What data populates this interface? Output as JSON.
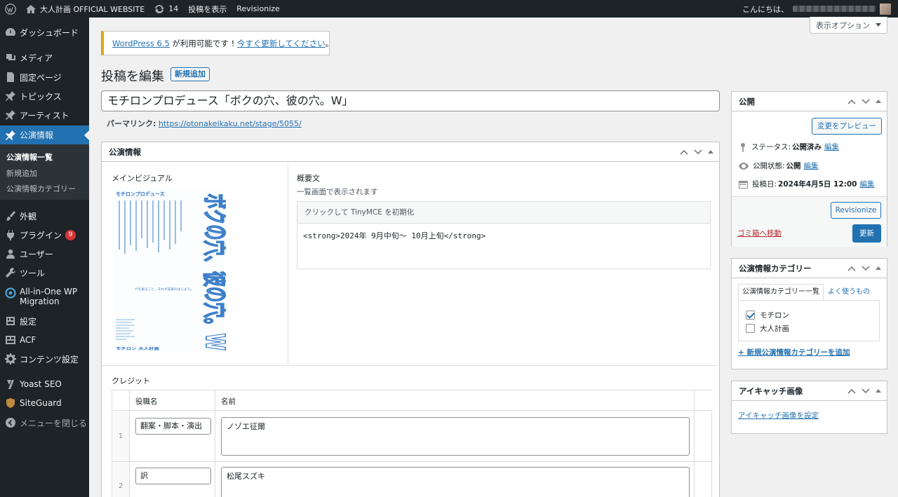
{
  "adminbar": {
    "site_name": "大人計画 OFFICIAL WEBSITE",
    "updates_count": "14",
    "view_post": "投稿を表示",
    "revisionize": "Revisionize",
    "greeting": "こんにちは、"
  },
  "sidebar": {
    "items": [
      {
        "label": "ダッシュボード",
        "icon": "dashboard-icon"
      },
      {
        "label": "メディア",
        "icon": "media-icon"
      },
      {
        "label": "固定ページ",
        "icon": "page-icon"
      },
      {
        "label": "トピックス",
        "icon": "pin-icon"
      },
      {
        "label": "アーティスト",
        "icon": "pin-icon"
      },
      {
        "label": "公演情報",
        "icon": "pin-icon"
      },
      {
        "label": "外観",
        "icon": "brush-icon"
      },
      {
        "label": "プラグイン",
        "icon": "plugin-icon",
        "badge": "9"
      },
      {
        "label": "ユーザー",
        "icon": "user-icon"
      },
      {
        "label": "ツール",
        "icon": "wrench-icon"
      },
      {
        "label": "All-in-One WP",
        "label2": "Migration",
        "icon": "migration-icon"
      },
      {
        "label": "設定",
        "icon": "settings-icon"
      },
      {
        "label": "ACF",
        "icon": "acf-icon"
      },
      {
        "label": "コンテンツ設定",
        "icon": "gear-icon"
      },
      {
        "label": "Yoast SEO",
        "icon": "yoast-icon"
      },
      {
        "label": "SiteGuard",
        "icon": "shield-icon"
      },
      {
        "label": "メニューを閉じる",
        "icon": "collapse-icon"
      }
    ],
    "submenu": [
      "公演情報一覧",
      "新規追加",
      "公演情報カテゴリー"
    ]
  },
  "screen_options": "表示オプション",
  "notice": {
    "link1": "WordPress 6.5",
    "text": " が利用可能です ! ",
    "link2": "今すぐ更新してください",
    "end": "。"
  },
  "page": {
    "title": "投稿を編集",
    "add_new": "新規追加",
    "post_title": "モチロンプロデュース「ボクの穴、彼の穴。W」",
    "permalink_label": "パーマリンク:",
    "permalink_url": "https://otonakeikaku.net/stage/5055/"
  },
  "meta": {
    "title": "公演情報",
    "main_visual_label": "メインビジュアル",
    "summary_label": "概要文",
    "summary_desc": "一覧画面で表示されます",
    "tinymce_hint": "クリックして TinyMCE を初期化",
    "summary_value": "<strong>2024年 9月中旬〜 10月上旬</strong>",
    "credit_label": "クレジット",
    "col_role": "役職名",
    "col_name": "名前",
    "rows": [
      {
        "num": "1",
        "role": "翻案・脚本・演出",
        "name": "ノゾエ征爾"
      },
      {
        "num": "2",
        "role": "訳",
        "name": "松尾スズキ"
      }
    ]
  },
  "poster": {
    "brand": "モチロンプロデュース",
    "title": "ボクの穴、彼の穴。W",
    "tagline": "穴を掘ること、それが未来のはじまり。",
    "logo": "モチロン 大人計画"
  },
  "publish": {
    "title": "公開",
    "preview": "変更をプレビュー",
    "status_label": "ステータス:",
    "status_value": "公開済み",
    "visibility_label": "公開状態:",
    "visibility_value": "公開",
    "date_label": "投稿日:",
    "date_value": "2024年4月5日 12:00",
    "edit": "編集",
    "revisionize": "Revisionize",
    "trash": "ゴミ箱へ移動",
    "update": "更新"
  },
  "categories": {
    "title": "公演情報カテゴリー",
    "tab_all": "公演情報カテゴリー一覧",
    "tab_popular": "よく使うもの",
    "items": [
      {
        "label": "モチロン",
        "checked": true
      },
      {
        "label": "大人計画",
        "checked": false
      }
    ],
    "add_new": "+ 新規公演情報カテゴリーを追加"
  },
  "thumbnail": {
    "title": "アイキャッチ画像",
    "set": "アイキャッチ画像を設定"
  },
  "colors": {
    "admin_bg": "#1d2327",
    "accent": "#2271b1",
    "notice": "#dba617",
    "danger": "#b32d2e"
  }
}
